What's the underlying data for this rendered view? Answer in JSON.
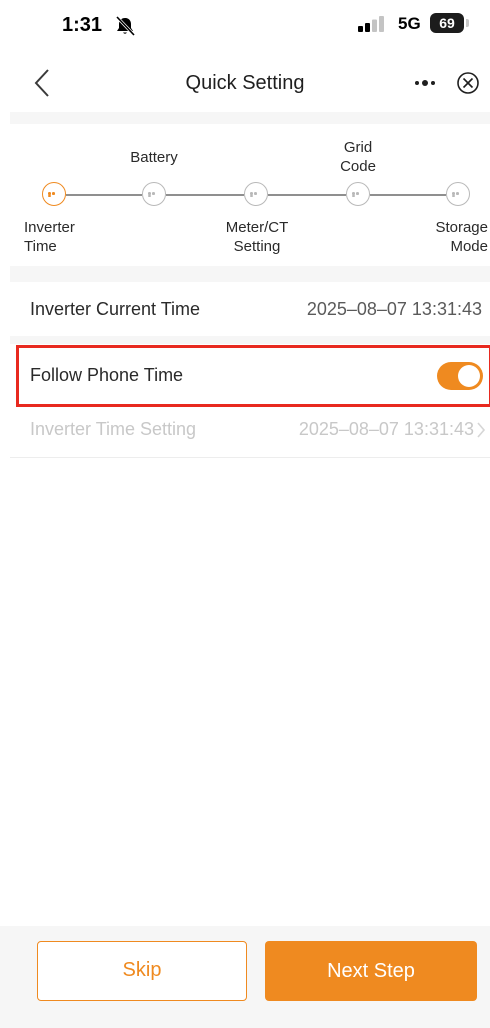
{
  "status_bar": {
    "time": "1:31",
    "network": "5G",
    "battery": "69"
  },
  "header": {
    "title": "Quick Setting",
    "more_icon": "more-dots-icon",
    "close_icon": "close-circle-icon",
    "back_icon": "chevron-left-icon"
  },
  "steps": [
    {
      "label": "Inverter\nTime",
      "state": "active"
    },
    {
      "label": "Battery",
      "state": "pending"
    },
    {
      "label": "Meter/CT\nSetting",
      "state": "pending"
    },
    {
      "label": "Grid\nCode",
      "state": "pending"
    },
    {
      "label": "Storage\nMode",
      "state": "pending"
    }
  ],
  "settings": {
    "current_time_label": "Inverter Current Time",
    "current_time_value": "2025–08–07 13:31:43",
    "follow_phone_label": "Follow Phone Time",
    "follow_phone_enabled": true,
    "time_setting_label": "Inverter Time Setting",
    "time_setting_value": "2025–08–07 13:31:43"
  },
  "footer": {
    "skip_label": "Skip",
    "next_label": "Next Step"
  },
  "colors": {
    "accent": "#ef8a20",
    "highlight": "#e8291f"
  }
}
